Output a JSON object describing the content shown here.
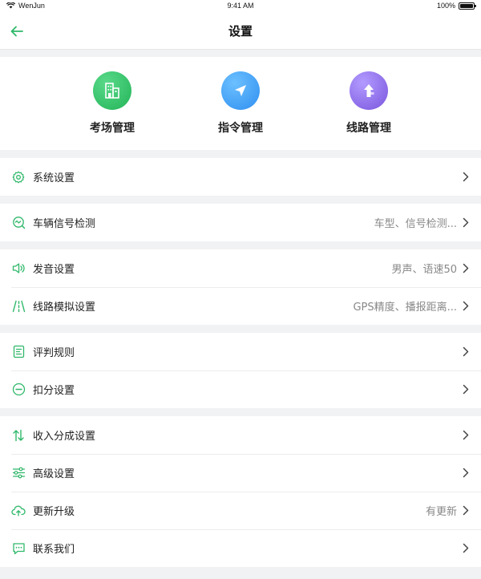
{
  "status": {
    "carrier": "WenJun",
    "time": "9:41 AM",
    "battery": "100%"
  },
  "nav": {
    "title": "设置",
    "back_icon": "arrow-left-icon"
  },
  "colors": {
    "accent": "#2fb86a",
    "quick_green": "#33c466",
    "quick_blue": "#3d9bf0",
    "quick_purple": "#8c6be6"
  },
  "quick": [
    {
      "label": "考场管理",
      "icon": "building-icon"
    },
    {
      "label": "指令管理",
      "icon": "navigation-icon"
    },
    {
      "label": "线路管理",
      "icon": "route-arrow-icon"
    }
  ],
  "groups": [
    [
      {
        "label": "系统设置",
        "value": "",
        "icon": "gear-icon"
      }
    ],
    [
      {
        "label": "车辆信号检测",
        "value": "车型、信号检测...",
        "icon": "signal-check-icon"
      }
    ],
    [
      {
        "label": "发音设置",
        "value": "男声、语速50",
        "icon": "speaker-icon"
      },
      {
        "label": "线路模拟设置",
        "value": "GPS精度、播报距离...",
        "icon": "road-icon"
      }
    ],
    [
      {
        "label": "评判规则",
        "value": "",
        "icon": "document-icon"
      },
      {
        "label": "扣分设置",
        "value": "",
        "icon": "minus-circle-icon"
      }
    ],
    [
      {
        "label": "收入分成设置",
        "value": "",
        "icon": "split-arrows-icon"
      },
      {
        "label": "高级设置",
        "value": "",
        "icon": "sliders-icon"
      },
      {
        "label": "更新升级",
        "value": "有更新",
        "icon": "cloud-upload-icon"
      },
      {
        "label": "联系我们",
        "value": "",
        "icon": "chat-icon"
      }
    ]
  ]
}
